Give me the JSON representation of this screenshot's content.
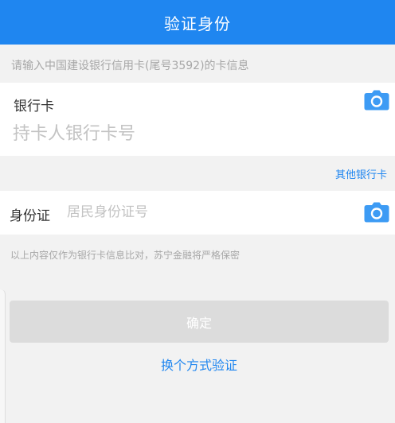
{
  "header": {
    "title": "验证身份"
  },
  "hint_top": "请输入中国建设银行信用卡(尾号3592)的卡信息",
  "card": {
    "label": "银行卡",
    "placeholder": "持卡人银行卡号",
    "camera_icon": "camera-icon"
  },
  "other_card_link": "其他银行卡",
  "id_card": {
    "label": "身份证",
    "placeholder": "居民身份证号",
    "camera_icon": "camera-icon"
  },
  "hint_bottom": "以上内容仅作为银行卡信息比对，苏宁金融将严格保密",
  "confirm_button": "确定",
  "switch_method_link": "换个方式验证",
  "colors": {
    "header": "#1f86f0",
    "link": "#1f86f0",
    "icon": "#3d9bf4",
    "button_disabled": "#dcdcdc",
    "background": "#f2f2f2"
  }
}
